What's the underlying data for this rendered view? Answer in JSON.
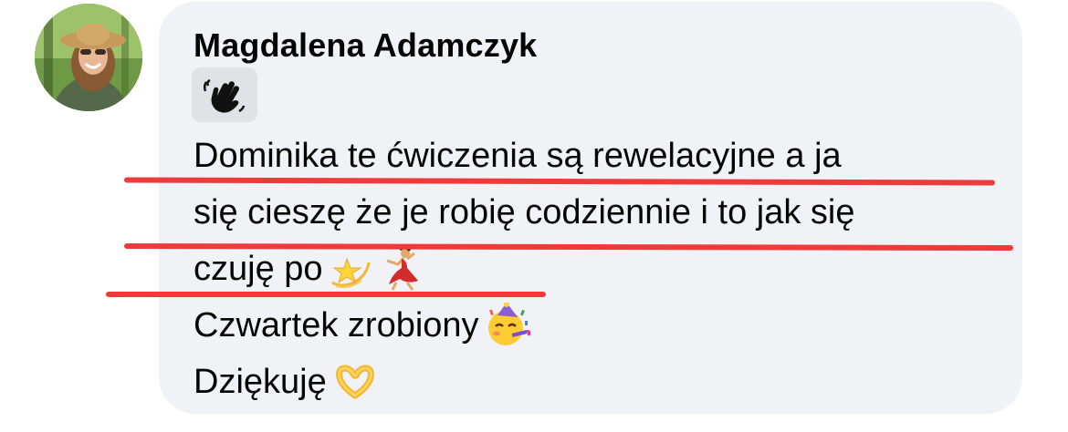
{
  "comment": {
    "author": "Magdalena Adamczyk",
    "sticker_icon": "waving-hand-icon",
    "lines": [
      "Dominika te ćwiczenia są rewelacyjne a ja",
      "się cieszę że je robię codziennie i to jak się",
      "czuję po",
      "Czwartek zrobiony",
      "Dziękuję"
    ],
    "emojis": {
      "line3": [
        "dizzy-star-icon",
        "dancer-icon"
      ],
      "line4": [
        "partying-face-icon"
      ],
      "line5": [
        "heart-hands-icon"
      ]
    }
  },
  "colors": {
    "bubble": "#f0f2f5",
    "text": "#050505",
    "markup_red": "#ec3b3a",
    "chip": "#e0e2e6"
  }
}
